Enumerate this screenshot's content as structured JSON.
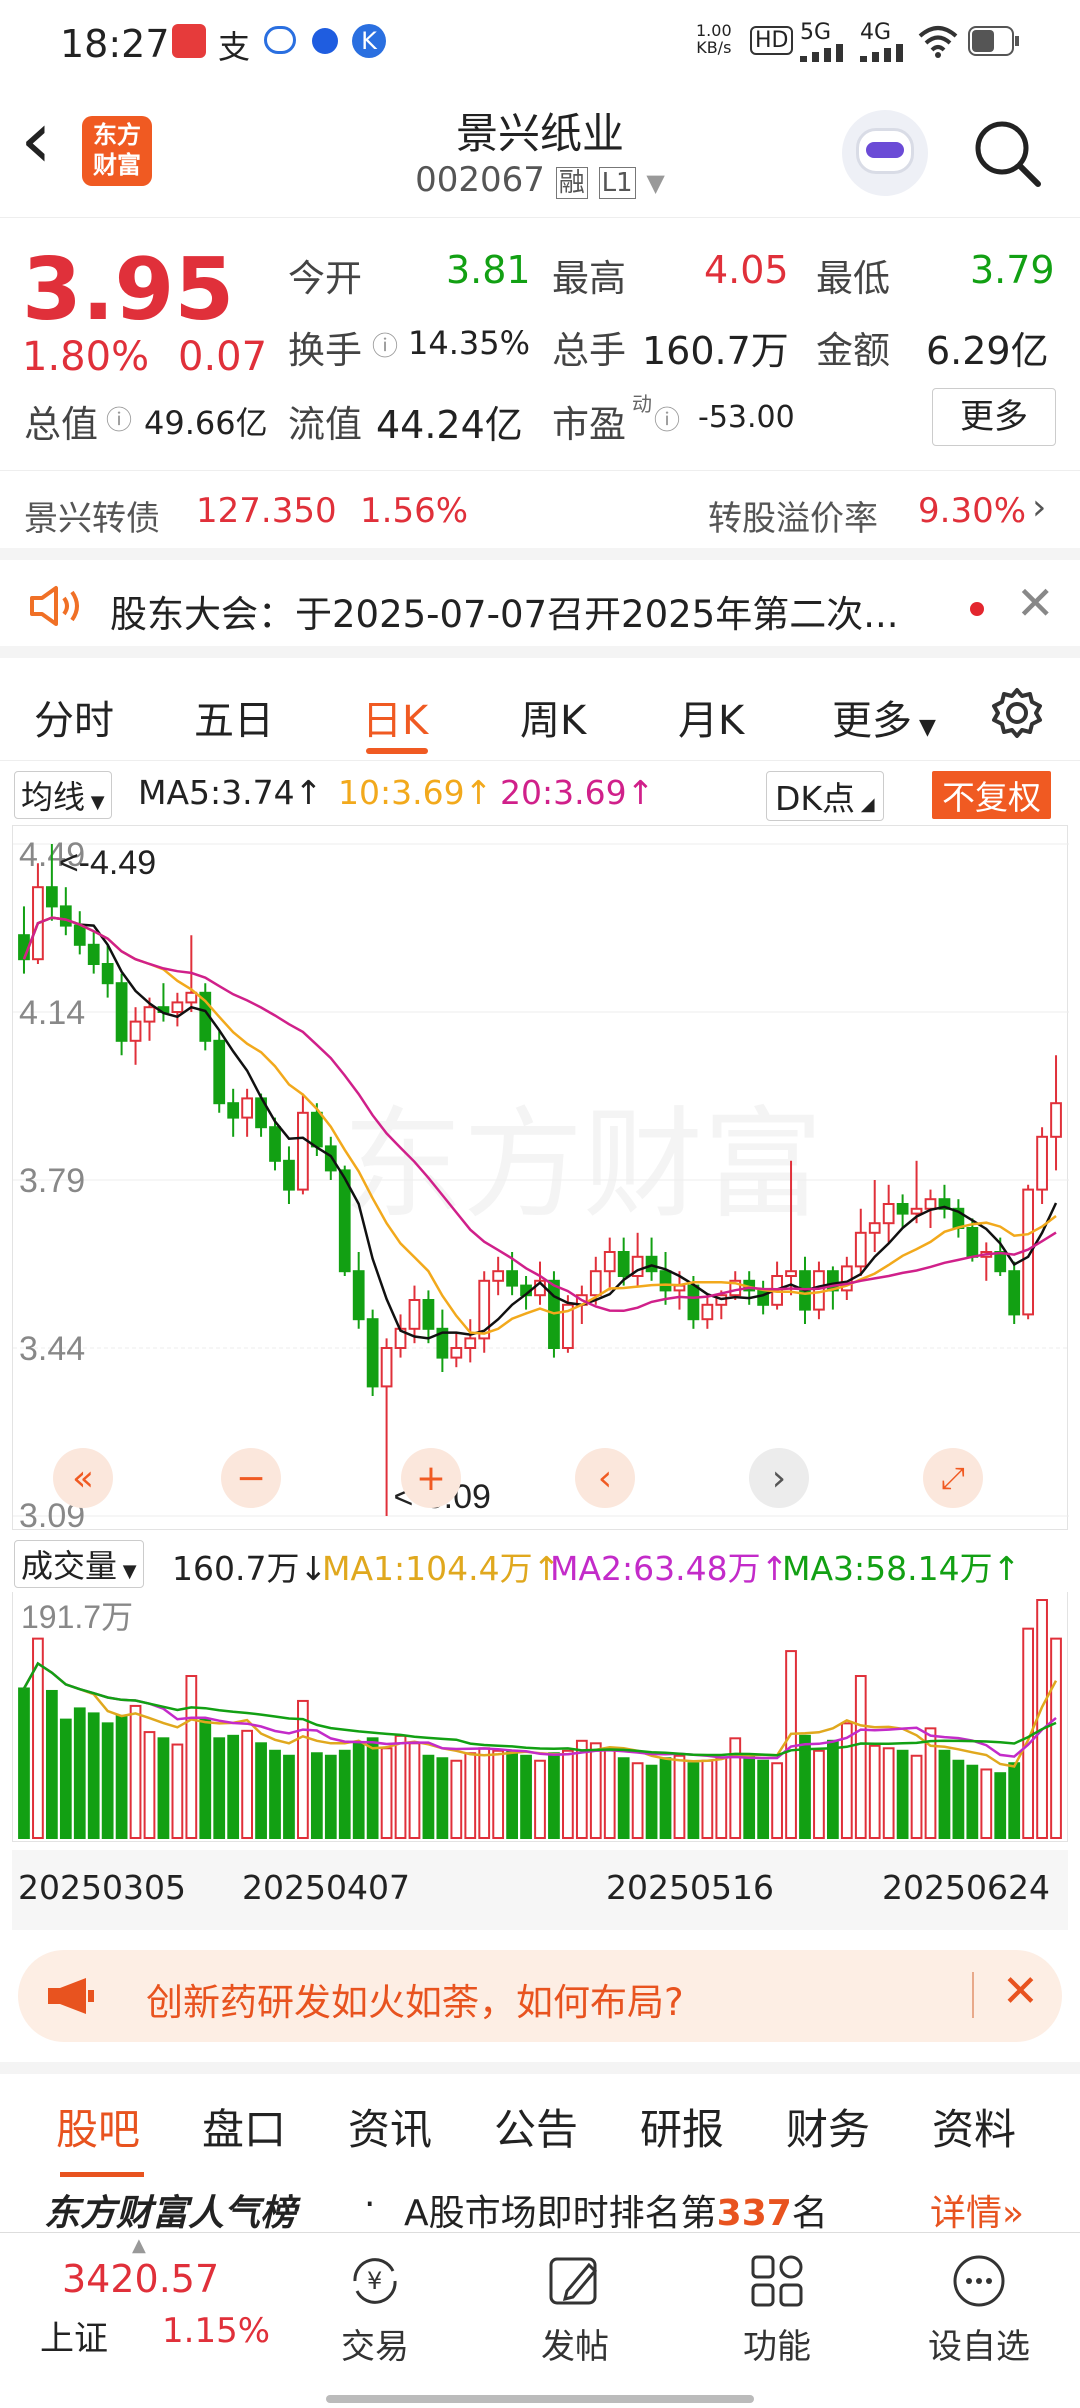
{
  "status": {
    "time": "18:27",
    "net_speed_top": "1.00",
    "net_speed_bottom": "KB/s",
    "sig1": "5G",
    "sig2": "4G"
  },
  "header": {
    "back": "‹",
    "logo_top": "东方",
    "logo_bottom": "财富",
    "title": "景兴纸业",
    "code": "002067",
    "tag1": "融",
    "tag2": "L1"
  },
  "quote": {
    "price": "3.95",
    "pct": "1.80%",
    "chg": "0.07",
    "open_label": "今开",
    "open": "3.81",
    "high_label": "最高",
    "high": "4.05",
    "low_label": "最低",
    "low": "3.79",
    "turnover_label": "换手",
    "turnover": "14.35%",
    "vol_label": "总手",
    "vol": "160.7万",
    "amount_label": "金额",
    "amount": "6.29亿",
    "mcap_label": "总值",
    "mcap": "49.66亿",
    "fmcap_label": "流值",
    "fmcap": "44.24亿",
    "pe_label": "市盈",
    "pe_sup": "动",
    "pe": "-53.00",
    "more": "更多"
  },
  "cb": {
    "name": "景兴转债",
    "price": "127.350",
    "pct": "1.56%",
    "premium_label": "转股溢价率",
    "premium": "9.30%"
  },
  "notice": {
    "text": "股东大会：于2025-07-07召开2025年第二次..."
  },
  "period_tabs": [
    "分时",
    "五日",
    "日K",
    "周K",
    "月K",
    "更多"
  ],
  "active_tab": "日K",
  "legend": {
    "ma_select": "均线",
    "ma5": "MA5:3.74↑",
    "ma10": "10:3.69↑",
    "ma20": "20:3.69↑",
    "dk": "DK点",
    "fq": "不复权"
  },
  "chart_data": {
    "type": "candlestick",
    "ylim": [
      3.09,
      4.49
    ],
    "y_ticks": [
      "4.49",
      "4.14",
      "3.79",
      "3.44",
      "3.09"
    ],
    "max_label": "<-4.49",
    "min_label": "<-3.09",
    "watermark": "东方财富",
    "x_ticks": [
      "20250305",
      "20250407",
      "20250516",
      "20250624"
    ],
    "ohlc": [
      [
        4.3,
        4.36,
        4.22,
        4.25
      ],
      [
        4.25,
        4.45,
        4.24,
        4.4
      ],
      [
        4.4,
        4.49,
        4.33,
        4.36
      ],
      [
        4.36,
        4.4,
        4.3,
        4.32
      ],
      [
        4.32,
        4.35,
        4.26,
        4.28
      ],
      [
        4.28,
        4.31,
        4.22,
        4.24
      ],
      [
        4.24,
        4.28,
        4.17,
        4.2
      ],
      [
        4.2,
        4.22,
        4.05,
        4.08
      ],
      [
        4.08,
        4.15,
        4.03,
        4.12
      ],
      [
        4.12,
        4.17,
        4.08,
        4.15
      ],
      [
        4.15,
        4.2,
        4.12,
        4.14
      ],
      [
        4.14,
        4.18,
        4.11,
        4.16
      ],
      [
        4.16,
        4.3,
        4.14,
        4.18
      ],
      [
        4.18,
        4.2,
        4.06,
        4.08
      ],
      [
        4.08,
        4.1,
        3.93,
        3.95
      ],
      [
        3.95,
        3.98,
        3.88,
        3.92
      ],
      [
        3.92,
        3.98,
        3.88,
        3.96
      ],
      [
        3.96,
        3.97,
        3.88,
        3.9
      ],
      [
        3.9,
        3.92,
        3.81,
        3.83
      ],
      [
        3.83,
        3.86,
        3.74,
        3.77
      ],
      [
        3.77,
        3.97,
        3.76,
        3.93
      ],
      [
        3.93,
        3.95,
        3.84,
        3.86
      ],
      [
        3.86,
        3.88,
        3.79,
        3.81
      ],
      [
        3.81,
        3.82,
        3.59,
        3.6
      ],
      [
        3.6,
        3.64,
        3.48,
        3.5
      ],
      [
        3.5,
        3.52,
        3.34,
        3.36
      ],
      [
        3.36,
        3.46,
        3.09,
        3.44
      ],
      [
        3.44,
        3.51,
        3.42,
        3.48
      ],
      [
        3.48,
        3.57,
        3.45,
        3.54
      ],
      [
        3.54,
        3.56,
        3.45,
        3.48
      ],
      [
        3.48,
        3.52,
        3.39,
        3.42
      ],
      [
        3.42,
        3.47,
        3.4,
        3.44
      ],
      [
        3.44,
        3.5,
        3.41,
        3.46
      ],
      [
        3.46,
        3.6,
        3.43,
        3.58
      ],
      [
        3.58,
        3.63,
        3.55,
        3.6
      ],
      [
        3.6,
        3.64,
        3.55,
        3.57
      ],
      [
        3.57,
        3.59,
        3.52,
        3.55
      ],
      [
        3.55,
        3.62,
        3.53,
        3.58
      ],
      [
        3.58,
        3.6,
        3.42,
        3.44
      ],
      [
        3.44,
        3.55,
        3.43,
        3.53
      ],
      [
        3.53,
        3.57,
        3.49,
        3.55
      ],
      [
        3.55,
        3.63,
        3.53,
        3.6
      ],
      [
        3.6,
        3.67,
        3.56,
        3.64
      ],
      [
        3.64,
        3.67,
        3.57,
        3.59
      ],
      [
        3.59,
        3.68,
        3.57,
        3.63
      ],
      [
        3.63,
        3.67,
        3.58,
        3.6
      ],
      [
        3.6,
        3.64,
        3.53,
        3.56
      ],
      [
        3.56,
        3.6,
        3.52,
        3.57
      ],
      [
        3.57,
        3.59,
        3.48,
        3.5
      ],
      [
        3.5,
        3.55,
        3.48,
        3.53
      ],
      [
        3.53,
        3.56,
        3.5,
        3.55
      ],
      [
        3.55,
        3.6,
        3.54,
        3.58
      ],
      [
        3.58,
        3.6,
        3.53,
        3.56
      ],
      [
        3.56,
        3.58,
        3.51,
        3.53
      ],
      [
        3.53,
        3.62,
        3.52,
        3.59
      ],
      [
        3.59,
        3.83,
        3.55,
        3.6
      ],
      [
        3.6,
        3.63,
        3.49,
        3.52
      ],
      [
        3.52,
        3.62,
        3.5,
        3.6
      ],
      [
        3.6,
        3.61,
        3.52,
        3.56
      ],
      [
        3.56,
        3.63,
        3.54,
        3.61
      ],
      [
        3.61,
        3.73,
        3.59,
        3.68
      ],
      [
        3.68,
        3.79,
        3.64,
        3.7
      ],
      [
        3.7,
        3.78,
        3.66,
        3.74
      ],
      [
        3.74,
        3.76,
        3.69,
        3.72
      ],
      [
        3.72,
        3.83,
        3.7,
        3.73
      ],
      [
        3.73,
        3.77,
        3.69,
        3.75
      ],
      [
        3.75,
        3.78,
        3.71,
        3.73
      ],
      [
        3.73,
        3.75,
        3.67,
        3.69
      ],
      [
        3.69,
        3.71,
        3.62,
        3.63
      ],
      [
        3.63,
        3.66,
        3.58,
        3.64
      ],
      [
        3.64,
        3.67,
        3.59,
        3.6
      ],
      [
        3.6,
        3.62,
        3.49,
        3.51
      ],
      [
        3.51,
        3.78,
        3.5,
        3.77
      ],
      [
        3.77,
        3.9,
        3.74,
        3.88
      ],
      [
        3.88,
        4.05,
        3.81,
        3.95
      ]
    ],
    "ma5_color": "#111111",
    "ma10_color": "#f2a91c",
    "ma20_color": "#d0208a"
  },
  "volume": {
    "select": "成交量",
    "last": "160.7万",
    "ma1": "MA1:104.4万↑",
    "ma2": "MA2:63.48万↑",
    "ma3": "MA3:58.14万↑",
    "max_label": "191.7万",
    "values": [
      120,
      160,
      118,
      95,
      104,
      100,
      92,
      98,
      106,
      85,
      80,
      75,
      130,
      95,
      80,
      82,
      86,
      76,
      70,
      66,
      110,
      68,
      66,
      70,
      76,
      80,
      72,
      82,
      76,
      66,
      64,
      62,
      68,
      72,
      70,
      70,
      66,
      62,
      68,
      70,
      78,
      76,
      72,
      64,
      60,
      58,
      64,
      66,
      60,
      62,
      64,
      80,
      66,
      62,
      60,
      150,
      82,
      70,
      78,
      92,
      130,
      74,
      72,
      70,
      66,
      88,
      70,
      62,
      58,
      55,
      52,
      60,
      168,
      191,
      160
    ]
  },
  "ad": {
    "text": "创新药研发如火如荼，如何布局?"
  },
  "bottom_tabs": [
    "股吧",
    "盘口",
    "资讯",
    "公告",
    "研报",
    "财务",
    "资料"
  ],
  "rank": {
    "brand": "东方财富人气榜",
    "text": "A股市场即时排名第",
    "num": "337",
    "unit": "名",
    "detail": "详情"
  },
  "index": {
    "value": "3420.57",
    "name": "上证",
    "pct": "1.15%"
  },
  "nav": [
    {
      "label": "交易",
      "icon": "yen-exchange-icon"
    },
    {
      "label": "发帖",
      "icon": "edit-icon"
    },
    {
      "label": "功能",
      "icon": "grid-icon"
    },
    {
      "label": "设自选",
      "icon": "more-icon"
    }
  ]
}
